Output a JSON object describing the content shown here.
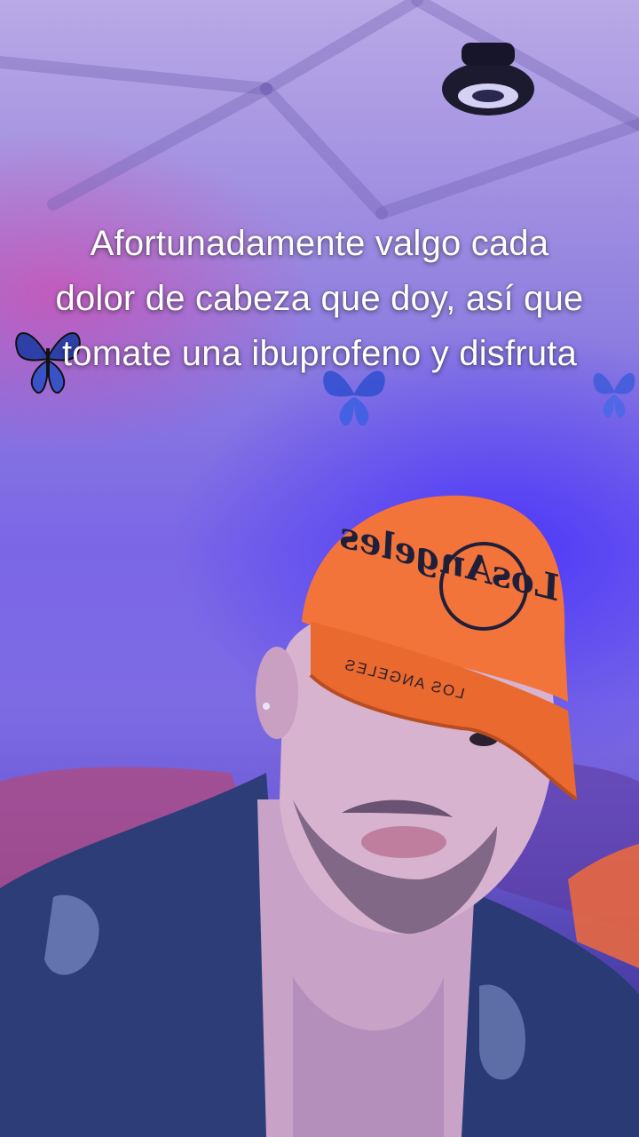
{
  "caption": {
    "text": "Afortunadamente valgo cada dolor de cabeza que doy, así que tomate una ibuprofeno y disfruta"
  },
  "cap": {
    "logo_text": "LosAngeles",
    "brim_text": "LOS ANGELES"
  },
  "colors": {
    "cap_orange": "#f2743a",
    "cap_embroidery": "#1f1f3a",
    "wall": "#7b67e6",
    "jacket": "#2c3d78"
  }
}
